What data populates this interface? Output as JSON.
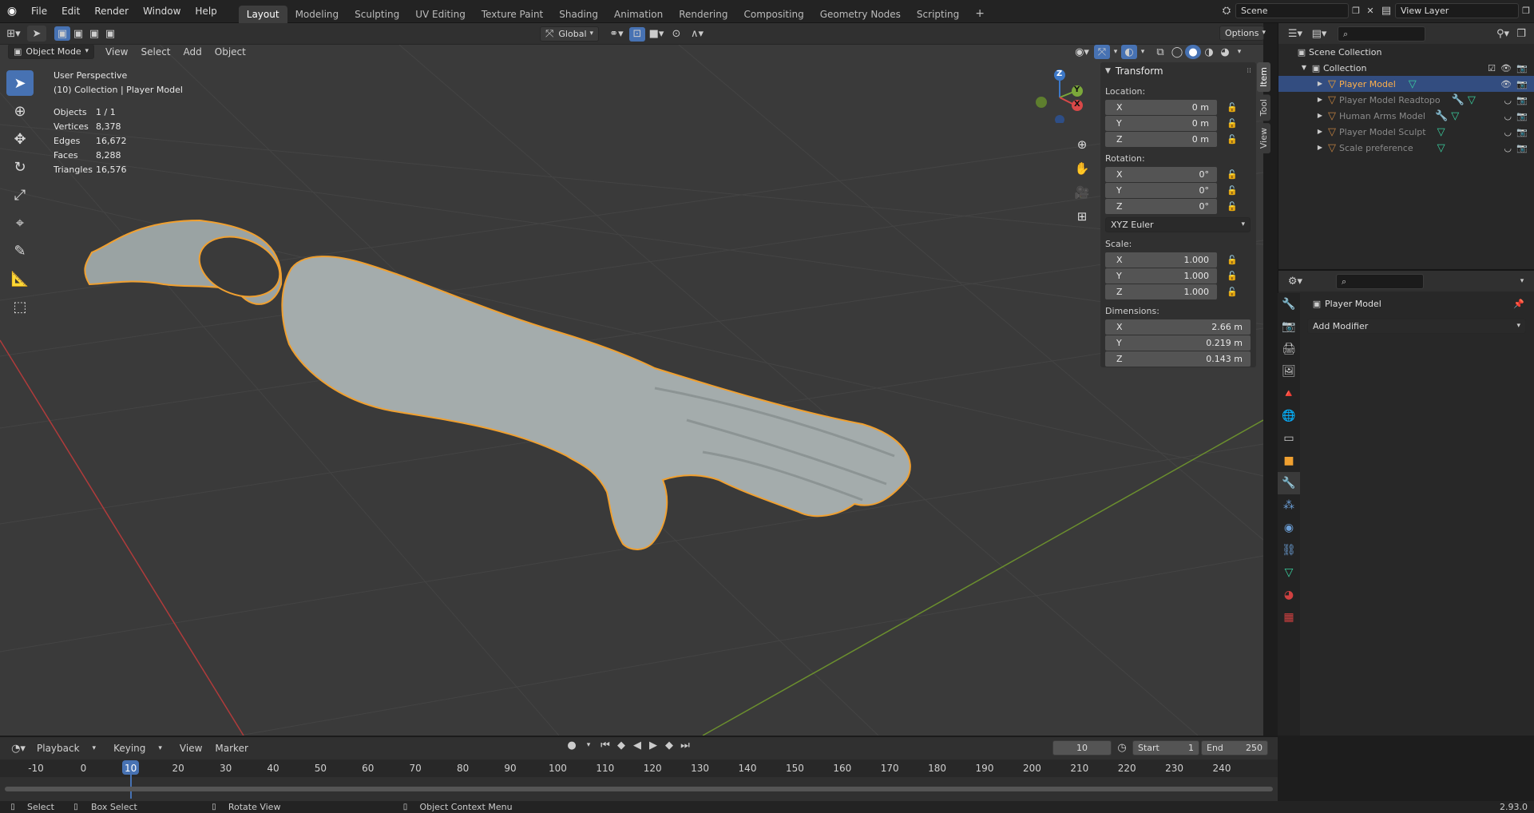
{
  "app": {
    "menu": [
      "File",
      "Edit",
      "Render",
      "Window",
      "Help"
    ],
    "workspaces": [
      "Layout",
      "Modeling",
      "Sculpting",
      "UV Editing",
      "Texture Paint",
      "Shading",
      "Animation",
      "Rendering",
      "Compositing",
      "Geometry Nodes",
      "Scripting"
    ],
    "active_workspace": "Layout",
    "scene": "Scene",
    "view_layer": "View Layer",
    "version": "2.93.0"
  },
  "viewport_header": {
    "mode": "Object Mode",
    "menu": [
      "View",
      "Select",
      "Add",
      "Object"
    ],
    "orientation": "Global",
    "options": "Options"
  },
  "overlay": {
    "perspective": "User Perspective",
    "collection_line": "(10) Collection | Player Model",
    "stats": [
      {
        "k": "Objects",
        "v": "1 / 1"
      },
      {
        "k": "Vertices",
        "v": "8,378"
      },
      {
        "k": "Edges",
        "v": "16,672"
      },
      {
        "k": "Faces",
        "v": "8,288"
      },
      {
        "k": "Triangles",
        "v": "16,576"
      }
    ]
  },
  "gizmo": {
    "z": "Z",
    "y": "Y",
    "x": "X"
  },
  "npanel": {
    "title": "Transform",
    "location_label": "Location:",
    "location": [
      {
        "a": "X",
        "v": "0 m"
      },
      {
        "a": "Y",
        "v": "0 m"
      },
      {
        "a": "Z",
        "v": "0 m"
      }
    ],
    "rotation_label": "Rotation:",
    "rotation": [
      {
        "a": "X",
        "v": "0°"
      },
      {
        "a": "Y",
        "v": "0°"
      },
      {
        "a": "Z",
        "v": "0°"
      }
    ],
    "rotation_mode": "XYZ Euler",
    "scale_label": "Scale:",
    "scale": [
      {
        "a": "X",
        "v": "1.000"
      },
      {
        "a": "Y",
        "v": "1.000"
      },
      {
        "a": "Z",
        "v": "1.000"
      }
    ],
    "dimensions_label": "Dimensions:",
    "dimensions": [
      {
        "a": "X",
        "v": "2.66 m"
      },
      {
        "a": "Y",
        "v": "0.219 m"
      },
      {
        "a": "Z",
        "v": "0.143 m"
      }
    ],
    "tabs": [
      "Item",
      "Tool",
      "View"
    ]
  },
  "outliner": {
    "root": "Scene Collection",
    "collection": "Collection",
    "items": [
      "Player Model",
      "Player Model Readtopo",
      "Human Arms Model",
      "Player Model Sculpt",
      "Scale preference"
    ]
  },
  "properties": {
    "object_name": "Player Model",
    "add_modifier": "Add Modifier"
  },
  "timeline": {
    "menu": [
      "Playback",
      "Keying",
      "View",
      "Marker"
    ],
    "current_frame": "10",
    "start_label": "Start",
    "start": "1",
    "end_label": "End",
    "end": "250",
    "ticks": [
      "-10",
      "0",
      "10",
      "20",
      "30",
      "40",
      "50",
      "60",
      "70",
      "80",
      "90",
      "100",
      "110",
      "120",
      "130",
      "140",
      "150",
      "160",
      "170",
      "180",
      "190",
      "200",
      "210",
      "220",
      "230",
      "240"
    ]
  },
  "status": {
    "select": "Select",
    "box_select": "Box Select",
    "rotate_view": "Rotate View",
    "context_menu": "Object Context Menu"
  },
  "colors": {
    "accent": "#4772b3",
    "selected_outline": "#f0a030",
    "x_axis": "#c83c3c",
    "y_axis": "#7fa83a"
  }
}
